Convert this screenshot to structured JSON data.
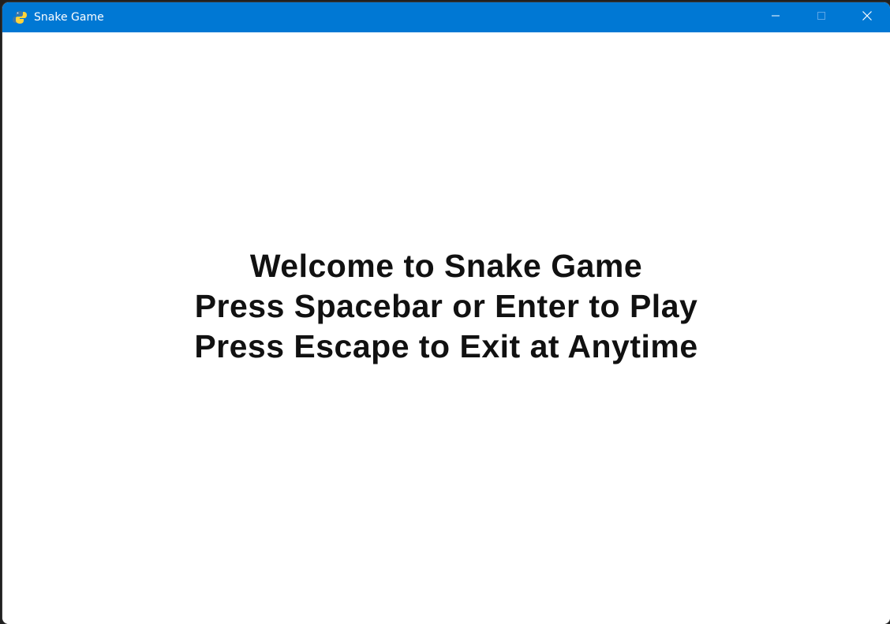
{
  "window": {
    "title": "Snake Game",
    "app_icon": "pygame-snake-icon",
    "accent_color": "#0078d4"
  },
  "caption": {
    "minimize_icon": "minimize-icon",
    "maximize_icon": "maximize-icon",
    "close_icon": "close-icon"
  },
  "game": {
    "background_color": "#ffffff",
    "text_color": "#111111",
    "lines": [
      "Welcome to Snake Game",
      "Press Spacebar or Enter to Play",
      "Press Escape to Exit at Anytime"
    ]
  }
}
